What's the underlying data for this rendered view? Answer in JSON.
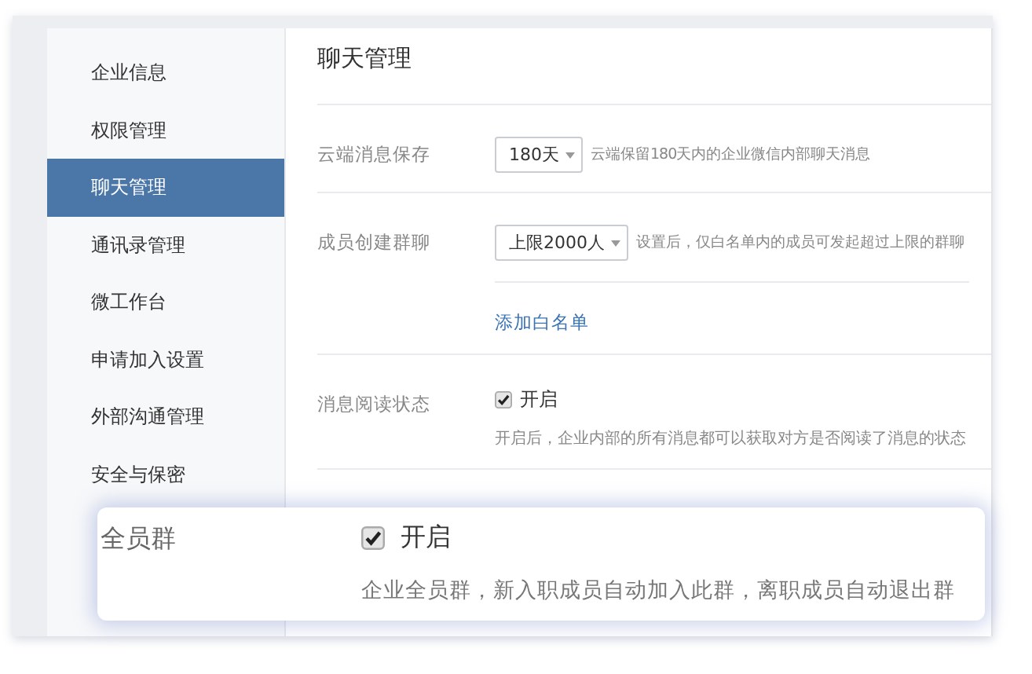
{
  "sidebar": {
    "items": [
      {
        "label": "企业信息",
        "selected": false
      },
      {
        "label": "权限管理",
        "selected": false
      },
      {
        "label": "聊天管理",
        "selected": true
      },
      {
        "label": "通讯录管理",
        "selected": false
      },
      {
        "label": "微工作台",
        "selected": false
      },
      {
        "label": "申请加入设置",
        "selected": false
      },
      {
        "label": "外部沟通管理",
        "selected": false
      },
      {
        "label": "安全与保密",
        "selected": false
      }
    ]
  },
  "main": {
    "title": "聊天管理",
    "settings": [
      {
        "kind": "select",
        "label": "云端消息保存",
        "value": "180天",
        "hint": "云端保留180天内的企业微信内部聊天消息"
      },
      {
        "kind": "select",
        "label": "成员创建群聊",
        "value": "上限2000人",
        "hint": "设置后，仅白名单内的成员可发起超过上限的群聊",
        "link": "添加白名单"
      },
      {
        "kind": "checkbox",
        "label": "消息阅读状态",
        "checked": true,
        "option": "开启",
        "description": "开启后，企业内部的所有消息都可以获取对方是否阅读了消息的状态"
      }
    ]
  },
  "callout": {
    "label": "全员群",
    "checked": true,
    "option": "开启",
    "description": "企业全员群，新入职成员自动加入此群，离职成员自动退出群"
  }
}
